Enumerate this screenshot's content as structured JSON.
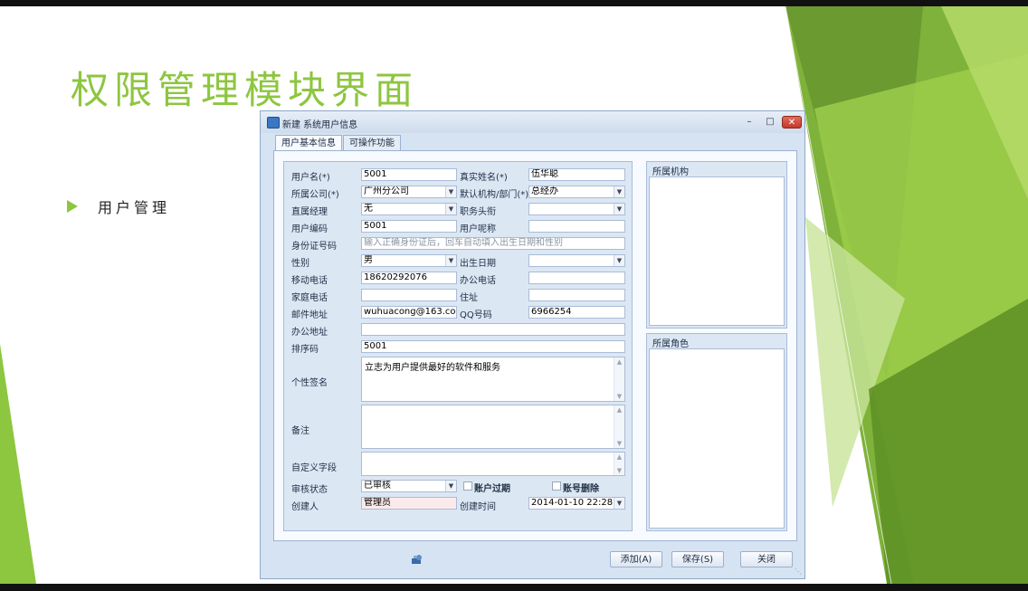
{
  "slide": {
    "title": "权限管理模块界面",
    "bullet": "用户管理"
  },
  "colors": {
    "accent": "#8dc63f",
    "window_bg": "#d6e3f2"
  },
  "window": {
    "title": "新建 系统用户信息",
    "tabs": [
      "用户基本信息",
      "可操作功能"
    ],
    "form": {
      "username": {
        "label": "用户名(*)",
        "value": "5001"
      },
      "realname": {
        "label": "真实姓名(*)",
        "value": "伍华聪"
      },
      "company": {
        "label": "所属公司(*)",
        "value": "广州分公司"
      },
      "dept": {
        "label": "默认机构/部门(*)",
        "value": "总经办"
      },
      "manager": {
        "label": "直属经理",
        "value": "无"
      },
      "position": {
        "label": "职务头衔",
        "value": ""
      },
      "usercode": {
        "label": "用户编码",
        "value": "5001"
      },
      "nickname": {
        "label": "用户呢称",
        "value": ""
      },
      "idcard": {
        "label": "身份证号码",
        "placeholder": "输入正确身份证后，回车自动填入出生日期和性别"
      },
      "gender": {
        "label": "性别",
        "value": "男"
      },
      "birthday": {
        "label": "出生日期",
        "value": ""
      },
      "mobile": {
        "label": "移动电话",
        "value": "18620292076"
      },
      "officephone": {
        "label": "办公电话",
        "value": ""
      },
      "homephone": {
        "label": "家庭电话",
        "value": ""
      },
      "address": {
        "label": "住址",
        "value": ""
      },
      "email": {
        "label": "邮件地址",
        "value": "wuhuacong@163.com"
      },
      "qq": {
        "label": "QQ号码",
        "value": "6966254"
      },
      "officeaddr": {
        "label": "办公地址",
        "value": ""
      },
      "sortcode": {
        "label": "排序码",
        "value": "5001"
      },
      "signature": {
        "label": "个性签名",
        "value": "立志为用户提供最好的软件和服务"
      },
      "remark": {
        "label": "备注",
        "value": ""
      },
      "custom": {
        "label": "自定义字段",
        "value": ""
      },
      "audit": {
        "label": "审核状态",
        "value": "已审核"
      },
      "expired": {
        "label": "账户过期"
      },
      "deleted": {
        "label": "账号删除"
      },
      "creator": {
        "label": "创建人",
        "value": "管理员"
      },
      "createtime": {
        "label": "创建时间",
        "value": "2014-01-10 22:28"
      }
    },
    "groups": {
      "org": "所属机构",
      "role": "所属角色"
    },
    "buttons": {
      "add": "添加(A)",
      "save": "保存(S)",
      "close": "关闭"
    }
  }
}
